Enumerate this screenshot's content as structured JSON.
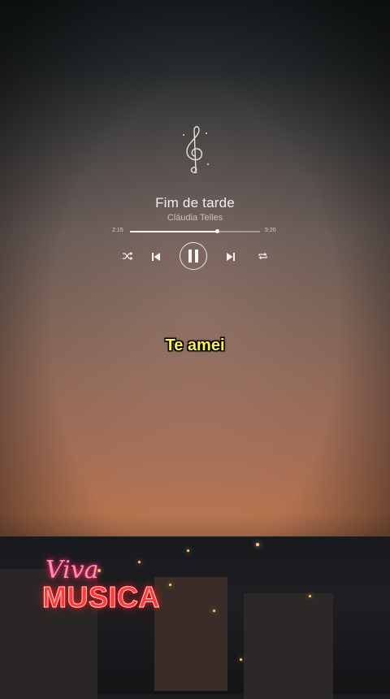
{
  "player": {
    "song_title": "Fim de tarde",
    "artist": "Cláudia Telles",
    "elapsed": "2:15",
    "duration": "5:20",
    "progress": 0.67,
    "state": "playing",
    "accent_color": "#f3f3f3"
  },
  "lyrics": {
    "current_line": "Te amei",
    "color": "#f7f255"
  },
  "branding": {
    "viva": "Viva",
    "musica": "MUSICA",
    "viva_color": "#ff8fb0",
    "musica_color": "#ff3a3a"
  },
  "icons": {
    "clef": "treble-clef-icon",
    "shuffle": "shuffle-icon",
    "previous": "skip-previous-icon",
    "pause": "pause-icon",
    "next": "skip-next-icon",
    "repeat": "repeat-icon"
  }
}
